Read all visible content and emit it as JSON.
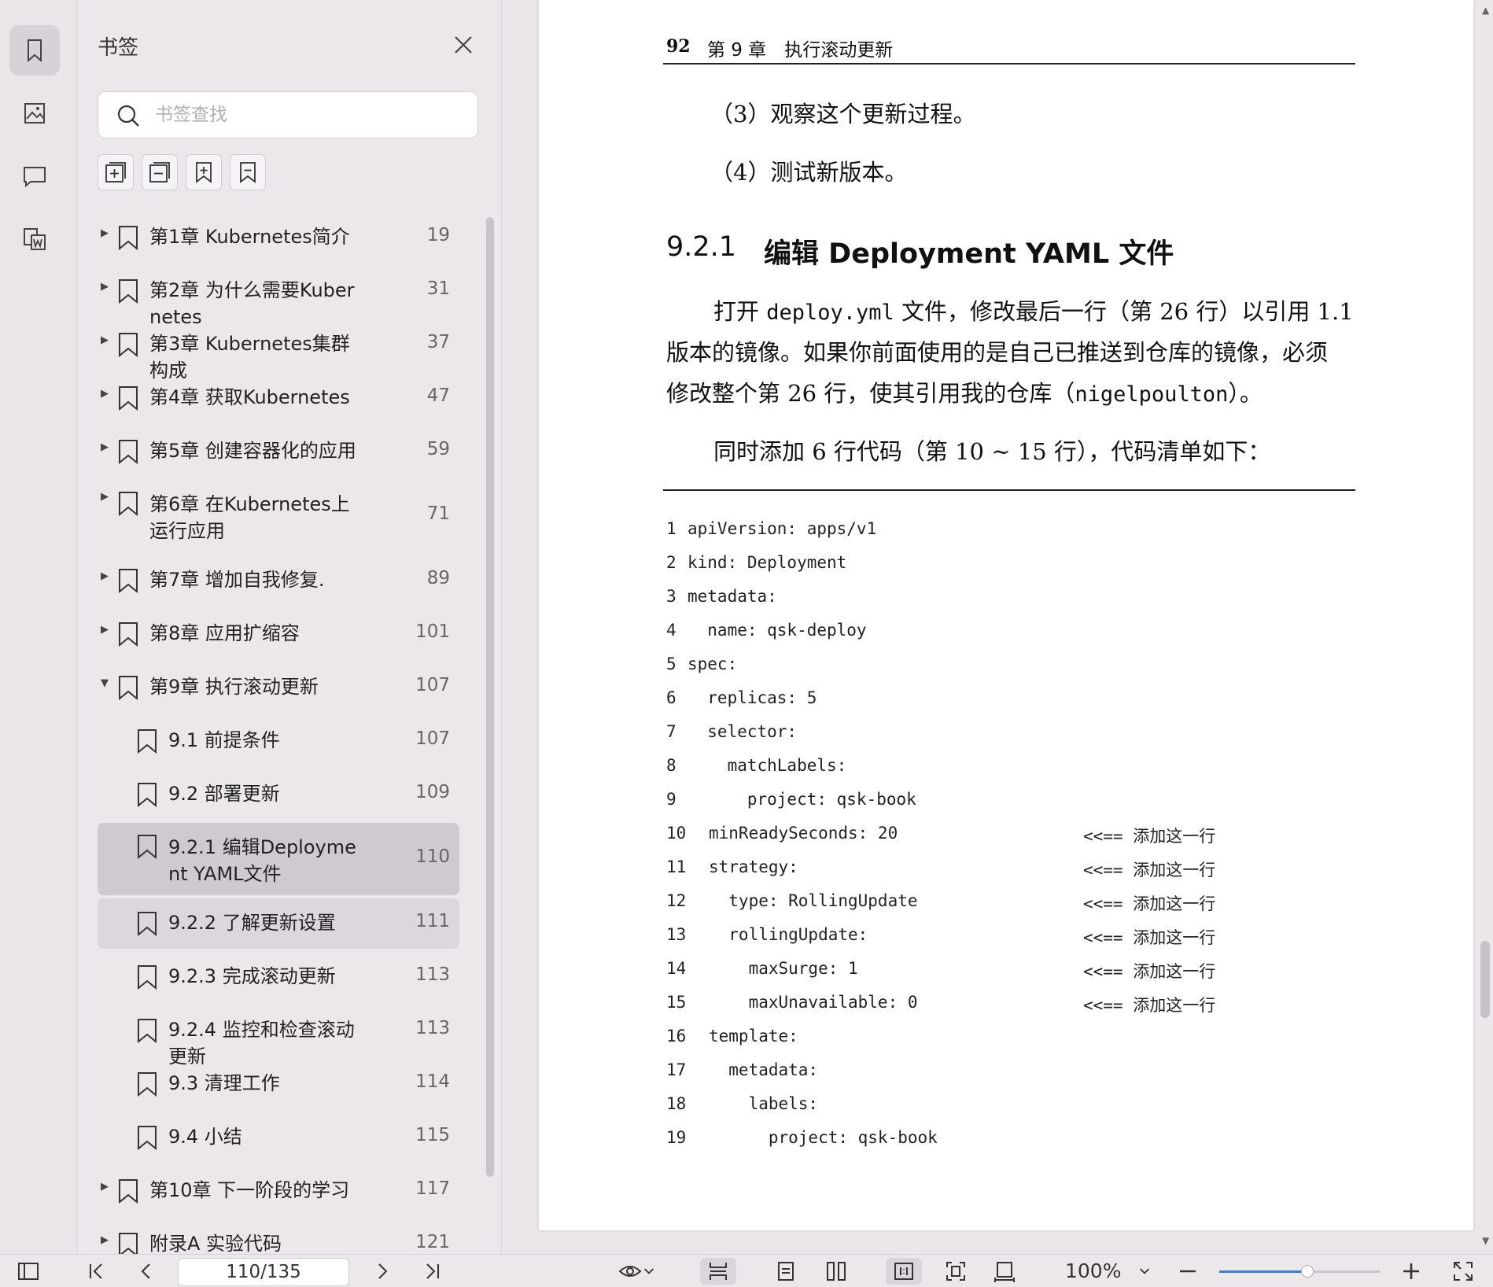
{
  "rail": {
    "items": [
      {
        "name": "bookmark",
        "active": true
      },
      {
        "name": "thumbnail",
        "active": false
      },
      {
        "name": "comment",
        "active": false
      },
      {
        "name": "annotate",
        "active": false
      }
    ]
  },
  "panel": {
    "title": "书签",
    "search_placeholder": "书签查找",
    "bookmarks": [
      {
        "label": "第1章 Kubernetes简介",
        "page": "19",
        "level": 0,
        "expand": "collapsed"
      },
      {
        "label": "第2章 为什么需要Kubernetes",
        "page": "31",
        "level": 0,
        "expand": "collapsed"
      },
      {
        "label": "第3章 Kubernetes集群构成",
        "page": "37",
        "level": 0,
        "expand": "collapsed"
      },
      {
        "label": "第4章 获取Kubernetes",
        "page": "47",
        "level": 0,
        "expand": "collapsed"
      },
      {
        "label": "第5章 创建容器化的应用",
        "page": "59",
        "level": 0,
        "expand": "collapsed"
      },
      {
        "label": "第6章 在Kubernetes上运行应用",
        "page": "71",
        "level": 0,
        "expand": "collapsed"
      },
      {
        "label": "第7章 增加自我修复.",
        "page": "89",
        "level": 0,
        "expand": "collapsed"
      },
      {
        "label": "第8章 应用扩缩容",
        "page": "101",
        "level": 0,
        "expand": "collapsed"
      },
      {
        "label": "第9章 执行滚动更新",
        "page": "107",
        "level": 0,
        "expand": "expanded"
      },
      {
        "label": "9.1 前提条件",
        "page": "107",
        "level": 1,
        "expand": "none"
      },
      {
        "label": "9.2 部署更新",
        "page": "109",
        "level": 1,
        "expand": "none"
      },
      {
        "label": "9.2.1 编辑Deployment YAML文件",
        "page": "110",
        "level": 1,
        "expand": "none",
        "state": "selected"
      },
      {
        "label": "9.2.2 了解更新设置",
        "page": "111",
        "level": 1,
        "expand": "none",
        "state": "hover"
      },
      {
        "label": "9.2.3 完成滚动更新",
        "page": "113",
        "level": 1,
        "expand": "none"
      },
      {
        "label": "9.2.4 监控和检查滚动更新",
        "page": "113",
        "level": 1,
        "expand": "none"
      },
      {
        "label": "9.3 清理工作",
        "page": "114",
        "level": 1,
        "expand": "none"
      },
      {
        "label": "9.4 小结",
        "page": "115",
        "level": 1,
        "expand": "none"
      },
      {
        "label": "第10章 下一阶段的学习",
        "page": "117",
        "level": 0,
        "expand": "collapsed"
      },
      {
        "label": "附录A 实验代码",
        "page": "121",
        "level": 0,
        "expand": "collapsed"
      }
    ]
  },
  "doc": {
    "header_page_num": "92",
    "header_chapter": "第 9 章　执行滚动更新",
    "steps": [
      "（3）观察这个更新过程。",
      "（4）测试新版本。"
    ],
    "section_number": "9.2.1",
    "section_title": "编辑 Deployment YAML 文件",
    "para1_a": "打开 ",
    "para1_code": "deploy.yml",
    "para1_b": " 文件，修改最后一行（第 26 行）以引用 1.1",
    "para2": "版本的镜像。如果你前面使用的是自己已推送到仓库的镜像，必须",
    "para3_a": "修改整个第 26 行，使其引用我的仓库（",
    "para3_code": "nigelpoulton",
    "para3_b": "）。",
    "para4": "同时添加 6 行代码（第 10 ~ 15 行），代码清单如下：",
    "code_lines": [
      {
        "n": "1",
        "text": "apiVersion: apps/v1",
        "note": ""
      },
      {
        "n": "2",
        "text": "kind: Deployment",
        "note": ""
      },
      {
        "n": "3",
        "text": "metadata:",
        "note": ""
      },
      {
        "n": "4",
        "text": "  name: qsk-deploy",
        "note": ""
      },
      {
        "n": "5",
        "text": "spec:",
        "note": ""
      },
      {
        "n": "6",
        "text": "  replicas: 5",
        "note": ""
      },
      {
        "n": "7",
        "text": "  selector:",
        "note": ""
      },
      {
        "n": "8",
        "text": "    matchLabels:",
        "note": ""
      },
      {
        "n": "9",
        "text": "      project: qsk-book",
        "note": ""
      },
      {
        "n": "10",
        "text": "minReadySeconds: 20",
        "note": "<<== 添加这一行"
      },
      {
        "n": "11",
        "text": "strategy:",
        "note": "<<== 添加这一行"
      },
      {
        "n": "12",
        "text": "  type: RollingUpdate",
        "note": "<<== 添加这一行"
      },
      {
        "n": "13",
        "text": "  rollingUpdate:",
        "note": "<<== 添加这一行"
      },
      {
        "n": "14",
        "text": "    maxSurge: 1",
        "note": "<<== 添加这一行"
      },
      {
        "n": "15",
        "text": "    maxUnavailable: 0",
        "note": "<<== 添加这一行"
      },
      {
        "n": "16",
        "text": "template:",
        "note": ""
      },
      {
        "n": "17",
        "text": "  metadata:",
        "note": ""
      },
      {
        "n": "18",
        "text": "    labels:",
        "note": ""
      },
      {
        "n": "19",
        "text": "      project: qsk-book",
        "note": ""
      }
    ]
  },
  "bottombar": {
    "page_indicator": "110/135",
    "zoom": "100%",
    "zoom_fraction": 0.55
  }
}
